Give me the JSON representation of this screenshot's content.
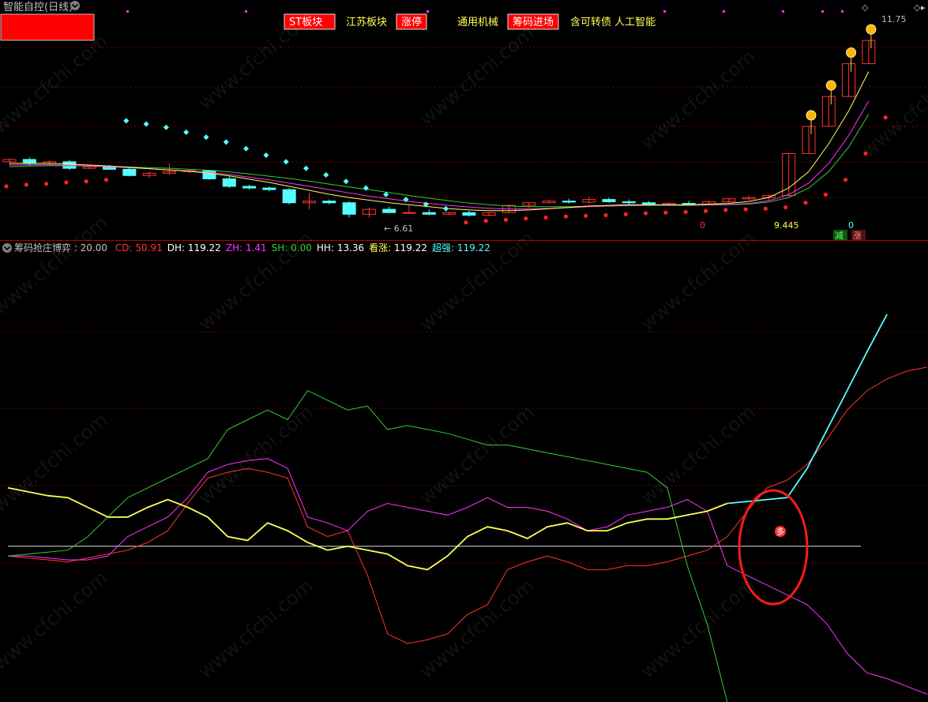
{
  "header": {
    "title": "智能自控(日线)",
    "right_label": "11.75",
    "tags": [
      {
        "text": "ST板块",
        "boxed": true
      },
      {
        "text": "江苏板块",
        "boxed": false
      },
      {
        "text": "涨停",
        "boxed": true
      },
      {
        "text": "通用机械",
        "boxed": false
      },
      {
        "text": "筹码进场",
        "boxed": true
      },
      {
        "text": "含可转债 人工智能",
        "boxed": false
      }
    ]
  },
  "colors": {
    "up": "#ff3333",
    "down": "#54ffff",
    "ma_yellow": "#ffff55",
    "ma_magenta": "#ff33ff",
    "ma_green": "#33cc33",
    "grid": "#7a0000",
    "divider": "#b00000",
    "flag_bg": "#ff0000"
  },
  "main_panel": {
    "low_label": "6.61",
    "bottom_labels": [
      "0",
      "9.445",
      "0"
    ],
    "buttons": [
      "减",
      "涨"
    ]
  },
  "indicator": {
    "name": "筹码抢庄博弈 : 20.00",
    "items": [
      {
        "key": "CD",
        "label": "CD: 50.91",
        "color": "#ff3333"
      },
      {
        "key": "DH",
        "label": "DH: 119.22",
        "color": "#ffffff"
      },
      {
        "key": "ZH",
        "label": "ZH: 1.41",
        "color": "#ff33ff"
      },
      {
        "key": "SH",
        "label": "SH: 0.00",
        "color": "#33cc33"
      },
      {
        "key": "HH",
        "label": "HH: 13.36",
        "color": "#ffffff"
      },
      {
        "key": "KZ",
        "label": "看涨: 119.22",
        "color": "#ffff55"
      },
      {
        "key": "CQ",
        "label": "超强: 119.22",
        "color": "#54ffff"
      }
    ],
    "signal_glyph": "多",
    "watermark": "www.cfchi.com"
  },
  "chart_data": [
    {
      "type": "candlestick",
      "title": "智能自控(日线)",
      "ylim": [
        6.0,
        12.5
      ],
      "low_label": 6.61,
      "high_label": 11.75,
      "candles": [
        {
          "o": 8.05,
          "h": 8.15,
          "l": 7.95,
          "c": 8.12
        },
        {
          "o": 8.12,
          "h": 8.18,
          "l": 7.92,
          "c": 8.0
        },
        {
          "o": 8.0,
          "h": 8.1,
          "l": 7.95,
          "c": 8.05
        },
        {
          "o": 8.05,
          "h": 8.1,
          "l": 7.8,
          "c": 7.85
        },
        {
          "o": 7.85,
          "h": 7.95,
          "l": 7.82,
          "c": 7.9
        },
        {
          "o": 7.9,
          "h": 7.95,
          "l": 7.8,
          "c": 7.82
        },
        {
          "o": 7.82,
          "h": 7.86,
          "l": 7.6,
          "c": 7.63
        },
        {
          "o": 7.63,
          "h": 7.75,
          "l": 7.55,
          "c": 7.7
        },
        {
          "o": 7.7,
          "h": 8.0,
          "l": 7.65,
          "c": 7.75
        },
        {
          "o": 7.75,
          "h": 7.82,
          "l": 7.7,
          "c": 7.78
        },
        {
          "o": 7.78,
          "h": 7.8,
          "l": 7.5,
          "c": 7.53
        },
        {
          "o": 7.53,
          "h": 7.6,
          "l": 7.25,
          "c": 7.3
        },
        {
          "o": 7.3,
          "h": 7.35,
          "l": 7.2,
          "c": 7.25
        },
        {
          "o": 7.25,
          "h": 7.3,
          "l": 7.15,
          "c": 7.2
        },
        {
          "o": 7.2,
          "h": 7.25,
          "l": 6.75,
          "c": 6.8
        },
        {
          "o": 6.8,
          "h": 7.1,
          "l": 6.6,
          "c": 6.85
        },
        {
          "o": 6.85,
          "h": 6.9,
          "l": 6.75,
          "c": 6.8
        },
        {
          "o": 6.8,
          "h": 6.85,
          "l": 6.35,
          "c": 6.45
        },
        {
          "o": 6.45,
          "h": 6.65,
          "l": 6.35,
          "c": 6.6
        },
        {
          "o": 6.6,
          "h": 6.68,
          "l": 6.48,
          "c": 6.5
        },
        {
          "o": 6.5,
          "h": 6.72,
          "l": 6.45,
          "c": 6.5
        },
        {
          "o": 6.5,
          "h": 6.6,
          "l": 6.42,
          "c": 6.45
        },
        {
          "o": 6.45,
          "h": 6.52,
          "l": 6.42,
          "c": 6.5
        },
        {
          "o": 6.5,
          "h": 6.55,
          "l": 6.38,
          "c": 6.42
        },
        {
          "o": 6.42,
          "h": 6.52,
          "l": 6.38,
          "c": 6.5
        },
        {
          "o": 6.5,
          "h": 6.75,
          "l": 6.48,
          "c": 6.72
        },
        {
          "o": 6.72,
          "h": 6.82,
          "l": 6.65,
          "c": 6.8
        },
        {
          "o": 6.8,
          "h": 6.88,
          "l": 6.78,
          "c": 6.85
        },
        {
          "o": 6.85,
          "h": 6.92,
          "l": 6.78,
          "c": 6.82
        },
        {
          "o": 6.82,
          "h": 6.98,
          "l": 6.78,
          "c": 6.9
        },
        {
          "o": 6.9,
          "h": 6.95,
          "l": 6.8,
          "c": 6.83
        },
        {
          "o": 6.83,
          "h": 6.9,
          "l": 6.75,
          "c": 6.8
        },
        {
          "o": 6.8,
          "h": 6.85,
          "l": 6.7,
          "c": 6.75
        },
        {
          "o": 6.75,
          "h": 6.82,
          "l": 6.7,
          "c": 6.78
        },
        {
          "o": 6.78,
          "h": 6.86,
          "l": 6.72,
          "c": 6.76
        },
        {
          "o": 6.76,
          "h": 6.86,
          "l": 6.72,
          "c": 6.83
        },
        {
          "o": 6.83,
          "h": 6.95,
          "l": 6.8,
          "c": 6.92
        },
        {
          "o": 6.92,
          "h": 7.02,
          "l": 6.88,
          "c": 6.96
        },
        {
          "o": 6.96,
          "h": 7.05,
          "l": 6.88,
          "c": 7.02
        },
        {
          "o": 7.02,
          "h": 8.3,
          "l": 7.0,
          "c": 8.3
        },
        {
          "o": 8.3,
          "h": 9.13,
          "l": 8.3,
          "c": 9.13
        },
        {
          "o": 9.13,
          "h": 10.04,
          "l": 9.13,
          "c": 10.04
        },
        {
          "o": 10.04,
          "h": 11.04,
          "l": 10.04,
          "c": 11.04
        },
        {
          "o": 11.04,
          "h": 11.75,
          "l": 11.04,
          "c": 11.75
        }
      ],
      "ma_yellow": [
        8.0,
        8.0,
        8.0,
        7.98,
        7.95,
        7.92,
        7.88,
        7.84,
        7.8,
        7.76,
        7.7,
        7.62,
        7.52,
        7.42,
        7.3,
        7.18,
        7.06,
        6.96,
        6.88,
        6.8,
        6.74,
        6.68,
        6.62,
        6.58,
        6.56,
        6.56,
        6.58,
        6.62,
        6.66,
        6.7,
        6.72,
        6.74,
        6.74,
        6.74,
        6.74,
        6.76,
        6.78,
        6.84,
        6.96,
        7.25,
        7.75,
        8.6,
        9.6,
        10.8
      ],
      "ma_magenta": [
        7.95,
        7.96,
        7.96,
        7.94,
        7.92,
        7.9,
        7.87,
        7.84,
        7.8,
        7.77,
        7.72,
        7.66,
        7.58,
        7.5,
        7.4,
        7.3,
        7.2,
        7.1,
        7.0,
        6.92,
        6.84,
        6.78,
        6.72,
        6.67,
        6.63,
        6.61,
        6.61,
        6.63,
        6.65,
        6.68,
        6.7,
        6.72,
        6.73,
        6.73,
        6.73,
        6.74,
        6.75,
        6.78,
        6.86,
        7.05,
        7.4,
        8.0,
        8.85,
        9.9
      ],
      "ma_green": [
        7.9,
        7.92,
        7.93,
        7.93,
        7.92,
        7.91,
        7.89,
        7.87,
        7.85,
        7.82,
        7.79,
        7.74,
        7.68,
        7.61,
        7.54,
        7.46,
        7.37,
        7.28,
        7.2,
        7.11,
        7.02,
        6.94,
        6.86,
        6.79,
        6.74,
        6.7,
        6.68,
        6.68,
        6.68,
        6.69,
        6.7,
        6.71,
        6.72,
        6.72,
        6.72,
        6.73,
        6.74,
        6.76,
        6.82,
        6.96,
        7.25,
        7.75,
        8.5,
        9.5
      ],
      "sar": [
        7.3,
        7.35,
        7.38,
        7.42,
        7.45,
        7.5,
        9.3,
        9.2,
        9.1,
        8.95,
        8.8,
        8.65,
        8.45,
        8.25,
        8.05,
        7.85,
        7.65,
        7.45,
        7.25,
        7.05,
        6.9,
        6.75,
        6.62,
        6.2,
        6.25,
        6.28,
        6.32,
        6.35,
        6.38,
        6.4,
        6.42,
        6.45,
        6.48,
        6.5,
        6.52,
        6.55,
        6.58,
        6.6,
        6.62,
        6.66,
        6.8,
        7.05,
        7.5,
        8.3,
        9.4
      ],
      "sar_up": [
        true,
        true,
        true,
        true,
        true,
        true,
        false,
        false,
        false,
        false,
        false,
        false,
        false,
        false,
        false,
        false,
        false,
        false,
        false,
        false,
        false,
        false,
        false,
        true,
        true,
        true,
        true,
        true,
        true,
        true,
        true,
        true,
        true,
        true,
        true,
        true,
        true,
        true,
        true,
        true,
        true,
        true,
        true,
        true,
        true
      ],
      "bottom_labels": [
        0,
        9.445,
        0
      ]
    },
    {
      "type": "line",
      "title": "筹码抢庄博弈",
      "ylim": [
        -80,
        150
      ],
      "reference_line": 0,
      "series": [
        {
          "name": "CD",
          "values": [
            -5,
            -6,
            -7,
            -8,
            -6,
            -4,
            -2,
            2,
            8,
            22,
            35,
            38,
            40,
            38,
            35,
            10,
            5,
            8,
            -15,
            -45,
            -50,
            -48,
            -45,
            -35,
            -30,
            -12,
            -8,
            -5,
            -8,
            -12,
            -12,
            -10,
            -10,
            -8,
            -5,
            -2,
            5,
            18,
            30,
            34,
            42,
            55,
            70,
            80,
            86,
            90,
            92
          ]
        },
        {
          "name": "ZH",
          "values": [
            -5,
            -5,
            -6,
            -7,
            -7,
            -5,
            5,
            10,
            15,
            25,
            38,
            42,
            44,
            45,
            40,
            15,
            12,
            8,
            18,
            22,
            20,
            18,
            16,
            20,
            25,
            20,
            20,
            18,
            14,
            8,
            10,
            16,
            18,
            20,
            24,
            18,
            -10,
            -15,
            -20,
            -25,
            -30,
            -40,
            -55,
            -65,
            -68,
            -72,
            -76
          ]
        },
        {
          "name": "SH",
          "values": [
            -5,
            -4,
            -3,
            -2,
            5,
            15,
            25,
            30,
            35,
            40,
            45,
            60,
            65,
            70,
            65,
            80,
            75,
            70,
            72,
            60,
            62,
            60,
            58,
            55,
            52,
            52,
            50,
            48,
            46,
            44,
            42,
            40,
            38,
            30,
            -10,
            -40,
            -80
          ]
        },
        {
          "name": "看涨",
          "values": [
            30,
            28,
            26,
            25,
            20,
            15,
            15,
            20,
            24,
            20,
            15,
            5,
            3,
            12,
            8,
            2,
            -2,
            0,
            -2,
            -4,
            -10,
            -12,
            -5,
            5,
            10,
            8,
            4,
            10,
            12,
            8,
            8,
            12,
            14,
            14,
            16,
            18,
            22
          ]
        },
        {
          "name": "超强",
          "values": [
            22,
            23,
            24,
            25,
            40,
            60,
            80,
            100,
            119.22
          ]
        }
      ],
      "x_start": [
        0,
        0,
        0,
        0,
        36,
        0,
        0
      ],
      "signal_x": 39,
      "signal_y": 45
    }
  ]
}
